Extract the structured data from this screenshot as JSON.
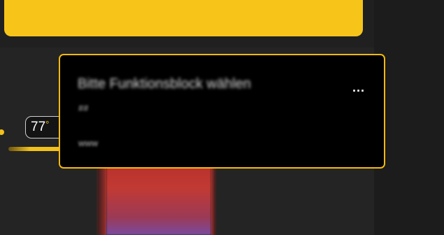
{
  "temperature": {
    "value": "77",
    "unit": "°"
  },
  "tooltip": {
    "title": "Bitte Funktionsblock wählen",
    "ellipsis": "...",
    "line1": "##",
    "line2": "www"
  },
  "colors": {
    "accent": "#f2c21a",
    "tooltip_border": "#f2b90f",
    "tooltip_background": "#000000",
    "background": "#262626"
  }
}
